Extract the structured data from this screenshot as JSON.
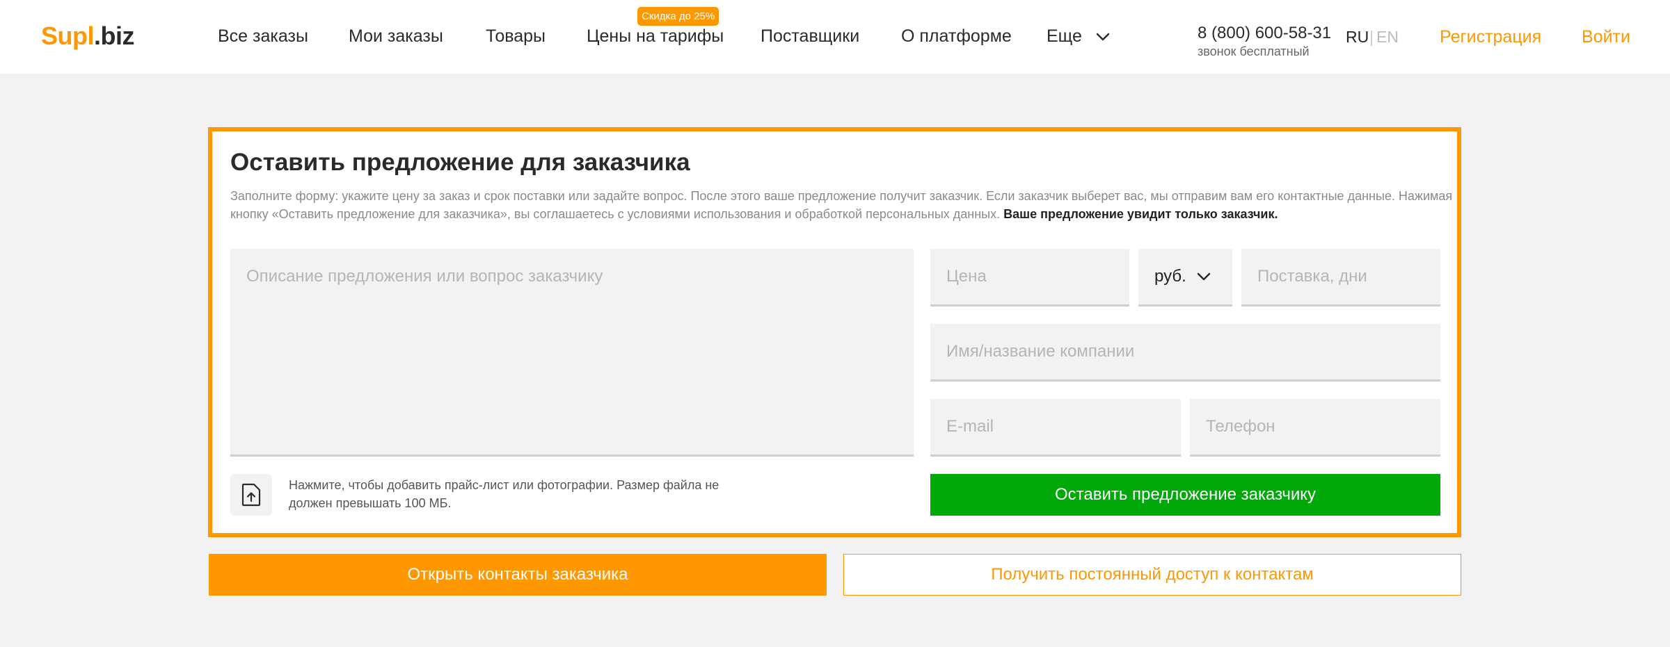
{
  "header": {
    "logo_part1": "Supl",
    "logo_part2": ".biz",
    "nav": [
      "Все заказы",
      "Мои заказы",
      "Товары",
      "Цены на тарифы",
      "Поставщики",
      "О платформе",
      "Еще"
    ],
    "discount_badge": "Скидка до 25%",
    "phone": "8 (800) 600-58-31",
    "phone_note": "звонок бесплатный",
    "lang_ru": "RU",
    "lang_sep": "|",
    "lang_en": "EN",
    "register": "Регистрация",
    "login": "Войти"
  },
  "form": {
    "title": "Оставить предложение для заказчика",
    "description": "Заполните форму: укажите цену за заказ и срок поставки или задайте вопрос. После этого ваше предложение получит заказчик. Если заказчик выберет вас, мы отправим вам его контактные данные. Нажимая кнопку «Оставить предложение для заказчика», вы соглашаетесь с условиями использования и обработкой персональных данных.",
    "description_bold": "Ваше предложение увидит только заказчик.",
    "message_placeholder": "Описание предложения или вопрос заказчику",
    "price_placeholder": "Цена",
    "currency": "руб.",
    "delivery_placeholder": "Поставка, дни",
    "company_placeholder": "Имя/название компании",
    "email_placeholder": "E-mail",
    "phone_placeholder": "Телефон",
    "upload_hint": "Нажмите, чтобы добавить прайс-лист или фотографии. Размер файла не должен превышать 100 МБ.",
    "submit": "Оставить предложение заказчику"
  },
  "actions": {
    "open_contacts": "Открыть контакты заказчика",
    "permanent_access": "Получить постоянный доступ к контактам"
  },
  "colors": {
    "accent": "#ff9800",
    "success": "#00a80a",
    "background": "#f2f2f2"
  }
}
